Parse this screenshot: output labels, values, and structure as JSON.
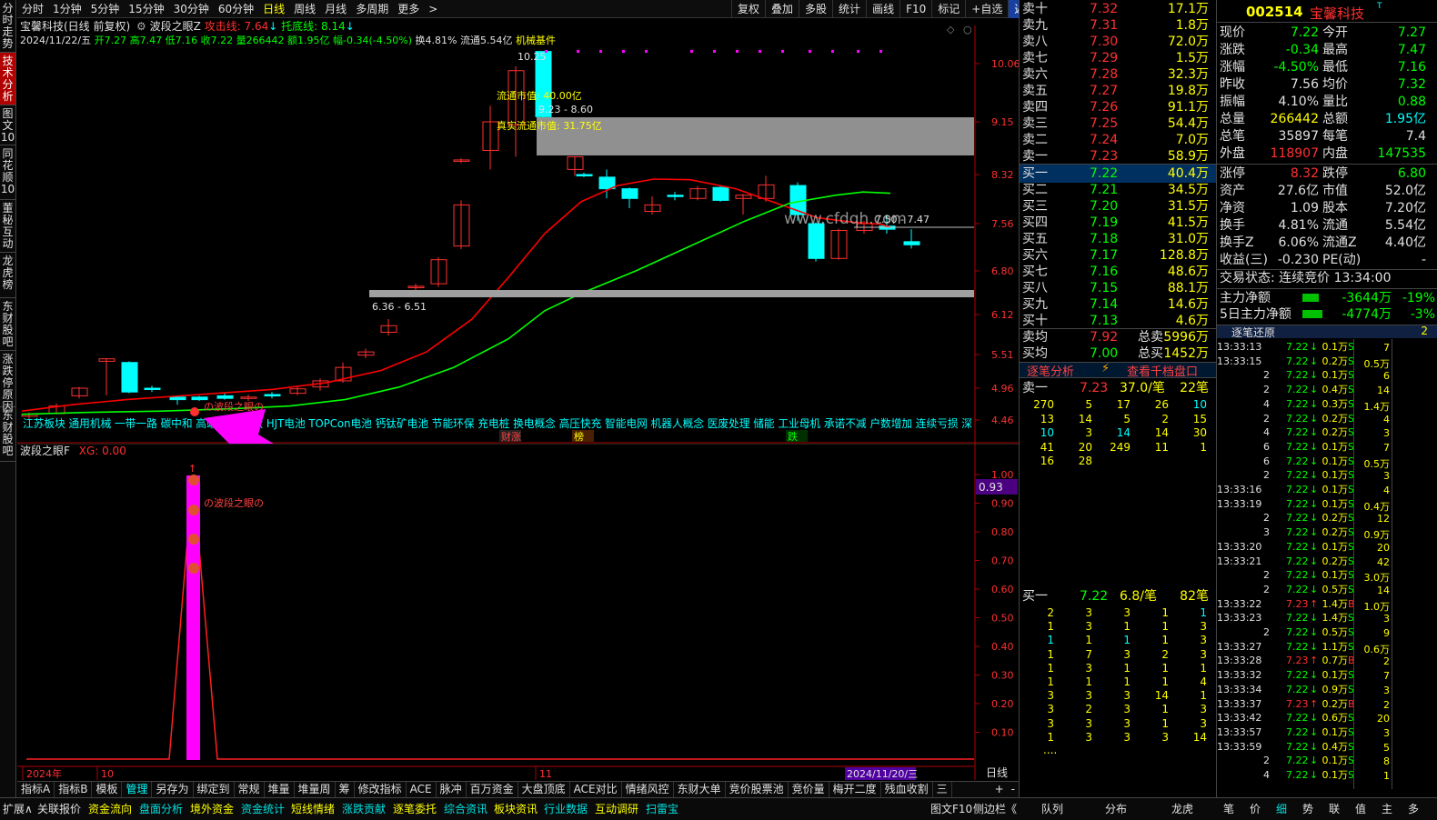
{
  "window": {
    "left_rail": [
      "分时走势",
      "技术分析",
      "图文10",
      "同花顺10",
      "董秘互动",
      "龙虎榜",
      "东财股吧",
      "涨跌停原因",
      "东财股吧"
    ]
  },
  "topbar": {
    "periods": [
      "分时",
      "1分钟",
      "5分钟",
      "15分钟",
      "30分钟",
      "60分钟",
      "日线",
      "周线",
      "月线",
      "多周期",
      "更多"
    ],
    "active": "日线",
    "right": [
      "复权",
      "叠加",
      "多股",
      "统计",
      "画线",
      "F10",
      "标记",
      "+自选",
      "返回"
    ]
  },
  "header": {
    "stock_title": "宝馨科技(日线 前复权)",
    "indicator": "波段之眼Z",
    "attack_label": "攻击线: 7.64",
    "support_label": "托底线: 8.14",
    "date_line": "2024/11/22/五",
    "ohlc": "开7.27 高7.47 低7.16 收7.22 量266442 额1.95亿",
    "change": "幅-0.34(-4.50%)",
    "turnover": "换4.81% 流通5.54亿",
    "sector": "机械基件"
  },
  "main_chart": {
    "y_ticks": [
      "10.06",
      "9.15",
      "8.32",
      "7.56",
      "6.80",
      "6.12",
      "5.51",
      "4.96",
      "4.46"
    ],
    "annotations": {
      "high": "10.25",
      "float_cap": "流通市值: 40.00亿",
      "band1": "9.23 - 8.60",
      "real_cap": "真实流通市值: 31.75亿",
      "band2": "6.36 - 6.51",
      "band3": "7.50 - 7.47",
      "signal": "の波段之眼の"
    },
    "concepts": "江苏板块 通用机械 一带一路 碳中和 高端装备 光伏 HJT电池 TOPCon电池 钙钛矿电池 节能环保 充电桩 换电概念 高压快充 智能电网 机器人概念 医废处理 储能 工业母机 承诺不减 户数增加 连续亏损 深",
    "tags": [
      "财涨",
      "榜",
      "跌"
    ]
  },
  "sub_chart": {
    "title": "波段之眼F",
    "value_label": "XG: 0.00",
    "y_ticks": [
      "1.00",
      "0.90",
      "0.80",
      "0.70",
      "0.60",
      "0.50",
      "0.40",
      "0.30",
      "0.20",
      "0.10"
    ],
    "current": "0.93",
    "signal": "の波段之眼の",
    "x_labels": [
      "2024年",
      "10",
      "11"
    ],
    "date_box": "2024/11/20/三",
    "period": "日线"
  },
  "bottom_tabs": [
    "指标A",
    "指标B",
    "模板",
    "管理",
    "另存为",
    "绑定到",
    "常规",
    "堆量",
    "堆量周",
    "筹",
    "修改指标",
    "ACE",
    "脉冲",
    "百万资金",
    "大盘顶底",
    "ACE对比",
    "情绪风控",
    "东财大单",
    "竞价股票池",
    "竞价量",
    "梅开二度",
    "残血收割",
    "三"
  ],
  "bottom_bar": [
    "扩展∧",
    "关联报价",
    "资金流向",
    "盘面分析",
    "境外资金",
    "资金统计",
    "短线情绪",
    "涨跌贡献",
    "逐笔委托",
    "综合资讯",
    "板块资讯",
    "行业数据",
    "互动调研",
    "扫雷宝",
    "图文F10",
    "侧边栏《"
  ],
  "quote": {
    "asks": [
      [
        "卖十",
        "7.32",
        "17.1万"
      ],
      [
        "卖九",
        "7.31",
        "1.8万"
      ],
      [
        "卖八",
        "7.30",
        "72.0万"
      ],
      [
        "卖七",
        "7.29",
        "1.5万"
      ],
      [
        "卖六",
        "7.28",
        "32.3万"
      ],
      [
        "卖五",
        "7.27",
        "19.8万"
      ],
      [
        "卖四",
        "7.26",
        "91.1万"
      ],
      [
        "卖三",
        "7.25",
        "54.4万"
      ],
      [
        "卖二",
        "7.24",
        "7.0万"
      ],
      [
        "卖一",
        "7.23",
        "58.9万"
      ]
    ],
    "bids": [
      [
        "买一",
        "7.22",
        "40.4万"
      ],
      [
        "买二",
        "7.21",
        "34.5万"
      ],
      [
        "买三",
        "7.20",
        "31.5万"
      ],
      [
        "买四",
        "7.19",
        "41.5万"
      ],
      [
        "买五",
        "7.18",
        "31.0万"
      ],
      [
        "买六",
        "7.17",
        "128.8万"
      ],
      [
        "买七",
        "7.16",
        "48.6万"
      ],
      [
        "买八",
        "7.15",
        "88.1万"
      ],
      [
        "买九",
        "7.14",
        "14.6万"
      ],
      [
        "买十",
        "7.13",
        "4.6万"
      ]
    ],
    "avg_sell": [
      "卖均",
      "7.92",
      "总卖",
      "5996万"
    ],
    "avg_buy": [
      "买均",
      "7.00",
      "总买",
      "1452万"
    ],
    "tab_a": "逐笔分析",
    "tab_b": "查看千档盘口",
    "sell1": [
      "卖一",
      "7.23",
      "37.0/笔",
      "22笔"
    ],
    "sell1_grid": [
      [
        "270",
        "13",
        "10",
        "41",
        "16"
      ],
      [
        "5",
        "14",
        "3",
        "20",
        "28"
      ],
      [
        "17",
        "5",
        "14",
        "249",
        ""
      ],
      [
        "26",
        "2",
        "14",
        "11",
        ""
      ],
      [
        "10",
        "15",
        "30",
        "1",
        ""
      ]
    ],
    "buy1": [
      "买一",
      "7.22",
      "6.8/笔",
      "82笔"
    ],
    "buy1_grid": [
      [
        "2",
        "1",
        "1",
        "1",
        "1",
        "1",
        "3",
        "3",
        "3",
        "1"
      ],
      [
        "3",
        "3",
        "1",
        "7",
        "3",
        "1",
        "3",
        "2",
        "3",
        "3"
      ],
      [
        "3",
        "1",
        "1",
        "3",
        "1",
        "1",
        "3",
        "3",
        "3",
        "3"
      ],
      [
        "1",
        "1",
        "1",
        "2",
        "1",
        "1",
        "14",
        "1",
        "1",
        "3"
      ],
      [
        "1",
        "3",
        "3",
        "3",
        "1",
        "4",
        "1",
        "3",
        "3",
        "14"
      ]
    ],
    "more": "...."
  },
  "detail": {
    "code": "002514",
    "name": "宝馨科技",
    "metrics": [
      [
        "现价",
        "7.22",
        "今开",
        "7.27"
      ],
      [
        "涨跌",
        "-0.34",
        "最高",
        "7.47"
      ],
      [
        "涨幅",
        "-4.50%",
        "最低",
        "7.16"
      ],
      [
        "昨收",
        "7.56",
        "均价",
        "7.32"
      ],
      [
        "振幅",
        "4.10%",
        "量比",
        "0.88"
      ],
      [
        "总量",
        "266442",
        "总额",
        "1.95亿"
      ],
      [
        "总笔",
        "35897",
        "每笔",
        "7.4"
      ],
      [
        "外盘",
        "118907",
        "内盘",
        "147535"
      ]
    ],
    "metrics2": [
      [
        "涨停",
        "8.32",
        "跌停",
        "6.80"
      ],
      [
        "资产",
        "27.6亿",
        "市值",
        "52.0亿"
      ],
      [
        "净资",
        "1.09",
        "股本",
        "7.20亿"
      ],
      [
        "换手",
        "4.81%",
        "流通",
        "5.54亿"
      ],
      [
        "换手Z",
        "6.06%",
        "流通Z",
        "4.40亿"
      ],
      [
        "收益(三)",
        "-0.230",
        "PE(动)",
        "-"
      ]
    ],
    "trade_status": "交易状态: 连续竞价 13:34:00",
    "main_flow": [
      "主力净额",
      "-3644万",
      "-19%"
    ],
    "main_flow5": [
      "5日主力净额",
      "-4774万",
      "-3%"
    ],
    "ticks_title": "逐笔还原",
    "ticks": [
      [
        "13:33:13",
        "7.22",
        "0.1万",
        "S"
      ],
      [
        "13:33:15",
        "7.22",
        "0.2万",
        "S"
      ],
      [
        "2",
        "7.22",
        "0.1万",
        "S"
      ],
      [
        "2",
        "7.22",
        "0.4万",
        "S"
      ],
      [
        "4",
        "7.22",
        "0.3万",
        "S"
      ],
      [
        "2",
        "7.22",
        "0.2万",
        "S"
      ],
      [
        "4",
        "7.22",
        "0.2万",
        "S"
      ],
      [
        "6",
        "7.22",
        "0.1万",
        "S"
      ],
      [
        "6",
        "7.22",
        "0.1万",
        "S"
      ],
      [
        "2",
        "7.22",
        "0.1万",
        "S"
      ],
      [
        "13:33:16",
        "7.22",
        "0.1万",
        "S"
      ],
      [
        "13:33:19",
        "7.22",
        "0.1万",
        "S"
      ],
      [
        "2",
        "7.22",
        "0.2万",
        "S"
      ],
      [
        "3",
        "7.22",
        "0.2万",
        "S"
      ],
      [
        "13:33:20",
        "7.22",
        "0.1万",
        "S"
      ],
      [
        "13:33:21",
        "7.22",
        "0.2万",
        "S"
      ],
      [
        "2",
        "7.22",
        "0.1万",
        "S"
      ],
      [
        "2",
        "7.22",
        "0.5万",
        "S"
      ],
      [
        "13:33:22",
        "7.23",
        "1.4万",
        "B"
      ],
      [
        "13:33:23",
        "7.22",
        "1.4万",
        "S"
      ],
      [
        "2",
        "7.22",
        "0.5万",
        "S"
      ],
      [
        "13:33:27",
        "7.22",
        "1.1万",
        "S"
      ],
      [
        "13:33:28",
        "7.23",
        "0.7万",
        "B"
      ],
      [
        "13:33:32",
        "7.22",
        "0.1万",
        "S"
      ],
      [
        "13:33:34",
        "7.22",
        "0.9万",
        "S"
      ],
      [
        "13:33:37",
        "7.23",
        "0.2万",
        "B"
      ],
      [
        "13:33:42",
        "7.22",
        "0.6万",
        "S"
      ],
      [
        "13:33:57",
        "7.22",
        "0.1万",
        "S"
      ],
      [
        "13:33:59",
        "7.22",
        "0.4万",
        "S"
      ],
      [
        "2",
        "7.22",
        "0.1万",
        "S"
      ],
      [
        "4",
        "7.22",
        "0.1万",
        "S"
      ]
    ],
    "side_counts": [
      "7",
      "0.5万",
      "6",
      "14",
      "1.4万",
      "4",
      "3",
      "7",
      "0.5万",
      "3",
      "4",
      "0.4万",
      "12",
      "0.9万",
      "20",
      "42",
      "3.0万",
      "14",
      "1.0万",
      "3",
      "9",
      "0.6万",
      "2",
      "7",
      "3",
      "2",
      "20",
      "3",
      "5",
      "8",
      "1"
    ],
    "tab_names": [
      "笔",
      "价",
      "细",
      "势",
      "联",
      "值",
      "主",
      "多"
    ],
    "tab_side": [
      "队列",
      "分布",
      "龙虎"
    ]
  },
  "colors": {
    "up": "#ff3030",
    "down": "#00ffff",
    "ma_fast": "#ff0000",
    "ma_slow": "#00ff00",
    "signal": "#ff00ff"
  },
  "watermark": "www.cfdqh.com"
}
